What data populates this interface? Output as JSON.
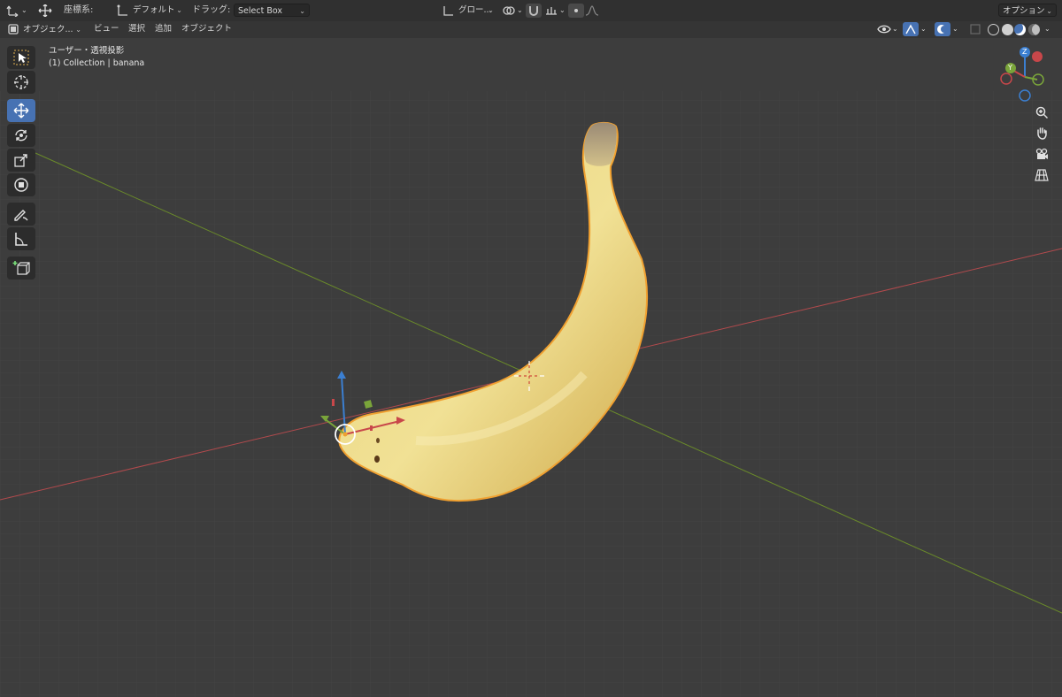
{
  "topbar": {
    "coord_label": "座標系:",
    "coord_value": "デフォルト",
    "drag_label": "ドラッグ:",
    "drag_value": "Select Box",
    "global_value": "グロー...",
    "options_label": "オプション"
  },
  "header": {
    "mode_value": "オブジェク...",
    "menu": [
      "ビュー",
      "選択",
      "追加",
      "オブジェクト"
    ]
  },
  "viewport": {
    "view_name": "ユーザー・透視投影",
    "collection_info": "(1) Collection | banana",
    "gizmo_axes": {
      "x": "X",
      "y": "Y",
      "z": "Z"
    }
  },
  "toolbar": {
    "tools": [
      "select-box",
      "cursor",
      "move",
      "rotate",
      "scale",
      "transform",
      "annotate",
      "measure",
      "add-cube"
    ],
    "active_tool": "move"
  },
  "colors": {
    "accent": "#4772b3",
    "selection_outline": "#f0a030",
    "axis_x": "#c8474a",
    "axis_y": "#7a9a2f",
    "axis_z": "#3b7fd1"
  },
  "icons": {
    "nav": [
      "zoom-icon",
      "hand-pan-icon",
      "camera-icon",
      "grid-perspective-icon"
    ]
  }
}
